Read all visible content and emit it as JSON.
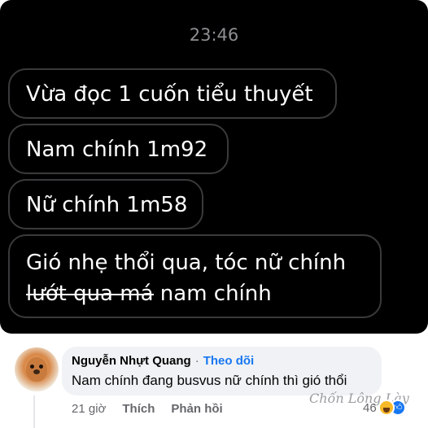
{
  "chat": {
    "time": "23:46",
    "messages": [
      "Vừa đọc 1 cuốn tiểu thuyết",
      "Nam chính 1m92",
      "Nữ chính 1m58"
    ],
    "message4_part1": "Gió nhẹ thổi qua, tóc nữ chính ",
    "message4_struck": "lướt qua má",
    "message4_part2": " nam chính"
  },
  "comment": {
    "author": "Nguyễn Nhựt Quang",
    "separator": "·",
    "follow_label": "Theo dõi",
    "text": "Nam chính đang busvus nữ chính thì gió thổi",
    "time": "21 giờ",
    "like_label": "Thích",
    "reply_label": "Phản hồi",
    "reaction_count": "46",
    "reaction_icons": [
      "haha-icon",
      "like-icon"
    ]
  },
  "watermark": "Chốn Lông Lày",
  "colors": {
    "chat_bg": "#000000",
    "bubble_border": "#3a3a3c",
    "comment_bg": "#f0f2f5",
    "link_blue": "#1877f2",
    "muted_text": "#65676b"
  }
}
